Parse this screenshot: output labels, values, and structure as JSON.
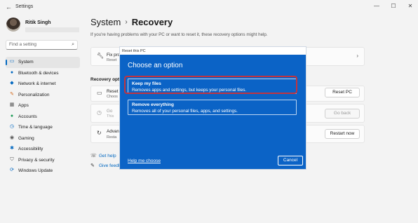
{
  "window": {
    "title": "Settings",
    "controls": [
      "—",
      "☐",
      "✕"
    ]
  },
  "profile": {
    "name": "Ritik Singh"
  },
  "search": {
    "placeholder": "Find a setting"
  },
  "sidebar": {
    "items": [
      {
        "label": "System",
        "icon": "system-icon",
        "active": true
      },
      {
        "label": "Bluetooth & devices",
        "icon": "bluetooth-icon"
      },
      {
        "label": "Network & internet",
        "icon": "network-icon"
      },
      {
        "label": "Personalization",
        "icon": "brush-icon"
      },
      {
        "label": "Apps",
        "icon": "apps-icon"
      },
      {
        "label": "Accounts",
        "icon": "accounts-icon"
      },
      {
        "label": "Time & language",
        "icon": "clock-icon"
      },
      {
        "label": "Gaming",
        "icon": "gaming-icon"
      },
      {
        "label": "Accessibility",
        "icon": "accessibility-icon"
      },
      {
        "label": "Privacy & security",
        "icon": "shield-icon"
      },
      {
        "label": "Windows Update",
        "icon": "update-icon"
      }
    ]
  },
  "breadcrumb": {
    "parent": "System",
    "separator": "›",
    "current": "Recovery"
  },
  "intro": "If you're having problems with your PC or want to reset it, these recovery options might help.",
  "fix_card": {
    "title": "Fix pro",
    "subtitle": "Reset"
  },
  "recovery_section": {
    "title": "Recovery optio",
    "reset": {
      "title": "Reset",
      "subtitle": "Choos",
      "button": "Reset PC"
    },
    "go_back": {
      "title": "Go",
      "subtitle": "This",
      "button": "Go back"
    },
    "advanced": {
      "title": "Advan",
      "subtitle": "Resta",
      "button": "Restart now"
    }
  },
  "links": {
    "help": "Get help",
    "feedback": "Give feedb"
  },
  "dialog": {
    "window_title": "Reset this PC",
    "heading": "Choose an option",
    "options": [
      {
        "title": "Keep my files",
        "description": "Removes apps and settings, but keeps your personal files."
      },
      {
        "title": "Remove everything",
        "description": "Removes all of your personal files, apps, and settings."
      }
    ],
    "help_link": "Help me choose",
    "cancel": "Cancel"
  },
  "colors": {
    "accent": "#0067c0",
    "dialog_bg": "#0b63c6",
    "highlight": "#c1343f"
  }
}
